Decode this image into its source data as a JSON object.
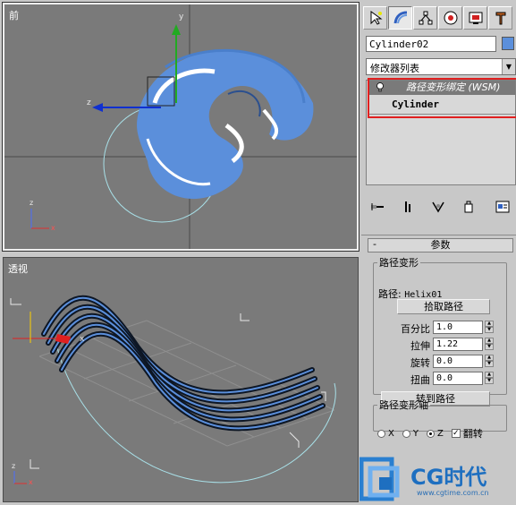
{
  "viewports": {
    "front": {
      "label": "前"
    },
    "perspective": {
      "label": "透视"
    }
  },
  "command_panel": {
    "tabs": [
      "create-icon",
      "modify-icon",
      "hierarchy-icon",
      "motion-icon",
      "display-icon",
      "utilities-icon"
    ],
    "active_tab": "modify-icon",
    "object_name": "Cylinder02",
    "object_color": "#5b8fdb",
    "modifier_list_label": "修改器列表",
    "stack": {
      "modifier": "路径变形绑定 (WSM)",
      "base_object": "Cylinder"
    },
    "stack_tools": [
      "pin-stack-icon",
      "show-end-result-icon",
      "make-unique-icon",
      "remove-modifier-icon",
      "configure-sets-icon"
    ]
  },
  "parameters": {
    "rollout_title": "参数",
    "rollout_toggle": "-",
    "path_deform": {
      "group_label": "路径变形",
      "path_label": "路径:",
      "path_value": "Helix01",
      "pick_path_button": "拾取路径",
      "percent_label": "百分比",
      "percent_value": "1.0",
      "stretch_label": "拉伸",
      "stretch_value": "1.22",
      "rotation_label": "旋转",
      "rotation_value": "0.0",
      "twist_label": "扭曲",
      "twist_value": "0.0",
      "convert_button": "转到路径"
    },
    "deform_axis": {
      "group_label": "路径变形轴",
      "axes": [
        "X",
        "Y",
        "Z"
      ],
      "selected_axis": "Z",
      "flip_label": "翻转",
      "flip_checked": true
    }
  },
  "watermark": {
    "brand": "CG时代",
    "url": "www.cgtime.com.cn"
  },
  "accent_colors": {
    "object_blue": "#5b8fdb",
    "highlight_red": "#e02020",
    "gizmo_green": "#22aa22",
    "gizmo_blue": "#1030d0"
  }
}
